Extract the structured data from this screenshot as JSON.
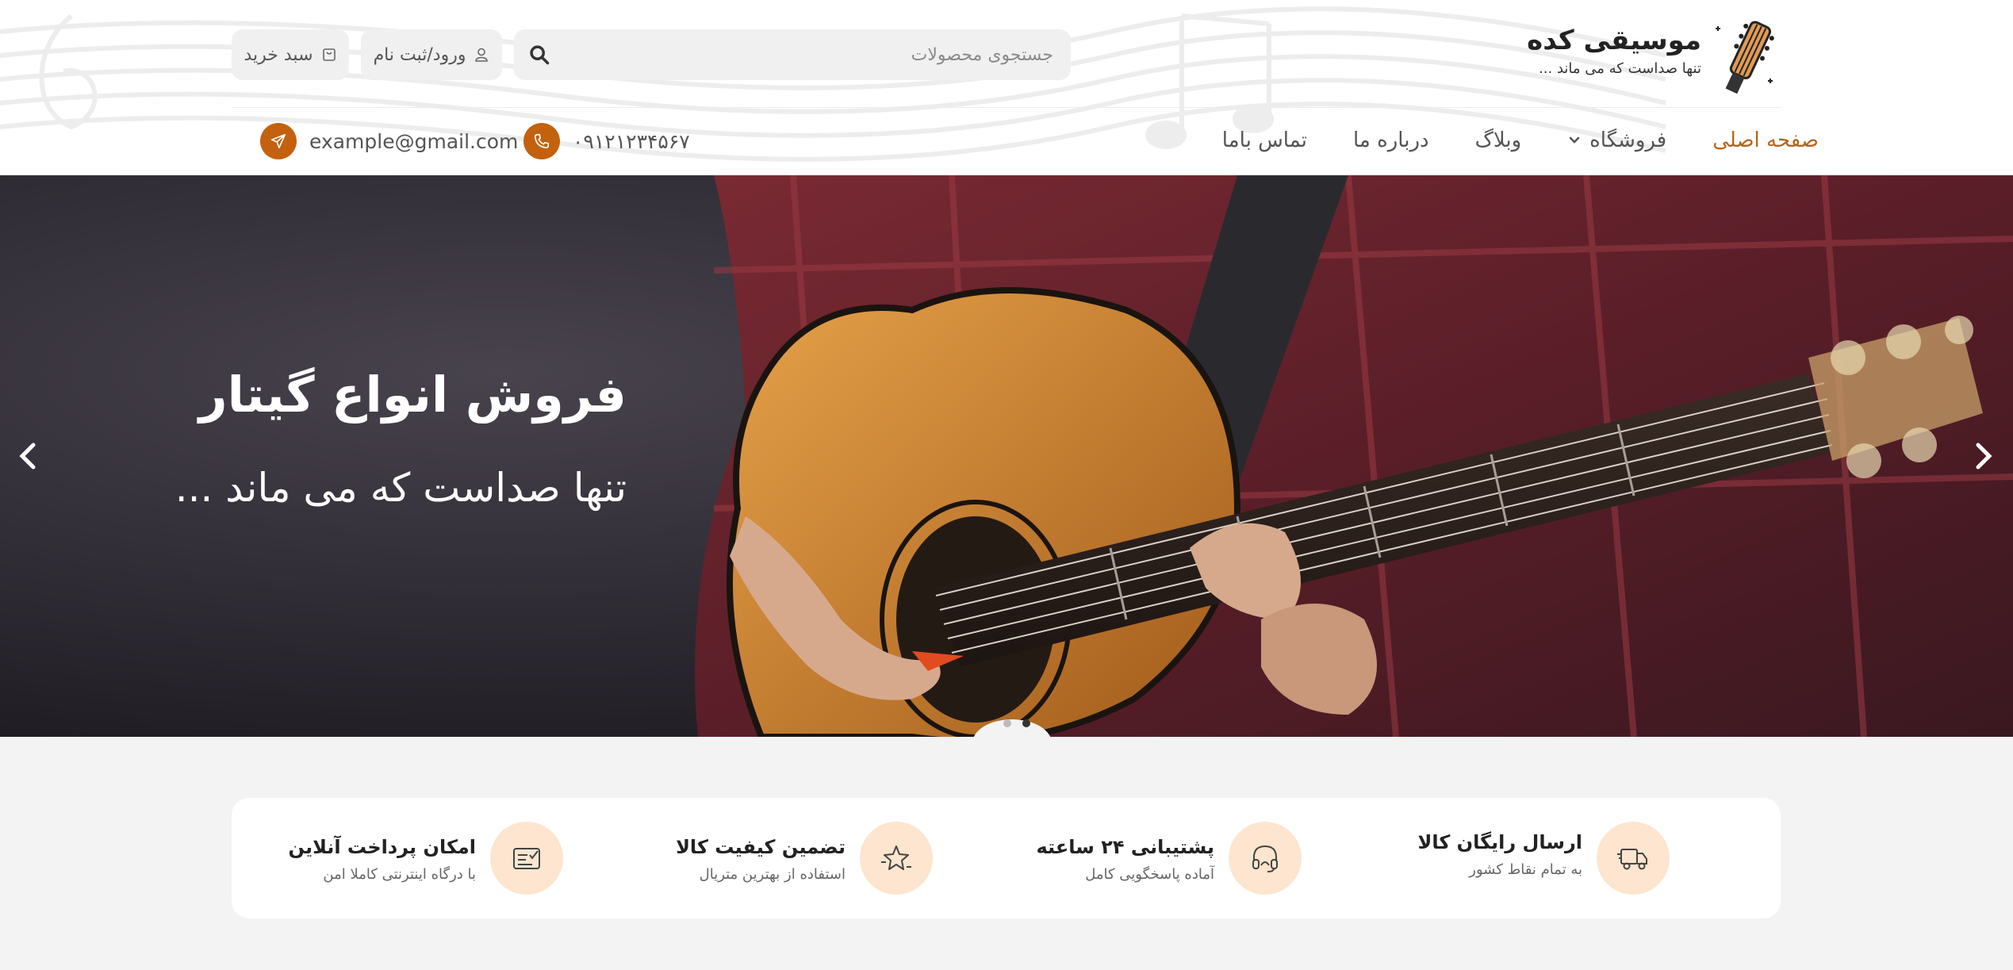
{
  "header": {
    "logo": {
      "title": "موسیقی کده",
      "subtitle": "تنها صداست که می ماند ..."
    },
    "search": {
      "placeholder": "جستجوی محصولات"
    },
    "login_label": "ورود/ثبت نام",
    "cart_label": "سبد خرید",
    "nav": [
      {
        "label": "صفحه اصلی",
        "active": true
      },
      {
        "label": "فروشگاه",
        "has_dropdown": true
      },
      {
        "label": "وبلاگ"
      },
      {
        "label": "درباره ما"
      },
      {
        "label": "تماس باما"
      }
    ],
    "phone": "۰۹۱۲۱۲۳۴۵۶۷",
    "email": "example@gmail.com"
  },
  "hero": {
    "title": "فروش انواع گیتار",
    "subtitle": "تنها صداست که می ماند ...",
    "slide_count": 2,
    "active_slide": 2
  },
  "features": [
    {
      "title": "ارسال رایگان کالا",
      "subtitle": "به تمام نقاط کشور",
      "icon": "truck-icon"
    },
    {
      "title": "پشتیبانی ۲۴ ساعته",
      "subtitle": "آماده پاسخگویی کامل",
      "icon": "headset-icon"
    },
    {
      "title": "تضمین کیفیت کالا",
      "subtitle": "استفاده از بهترین متریال",
      "icon": "star-badge-icon"
    },
    {
      "title": "امکان پرداخت آنلاین",
      "subtitle": "با درگاه اینترنتی کاملا امن",
      "icon": "payment-icon"
    }
  ],
  "colors": {
    "accent": "#c3610f",
    "accent_light": "#fde5cf",
    "nav_active": "#b5651d"
  }
}
